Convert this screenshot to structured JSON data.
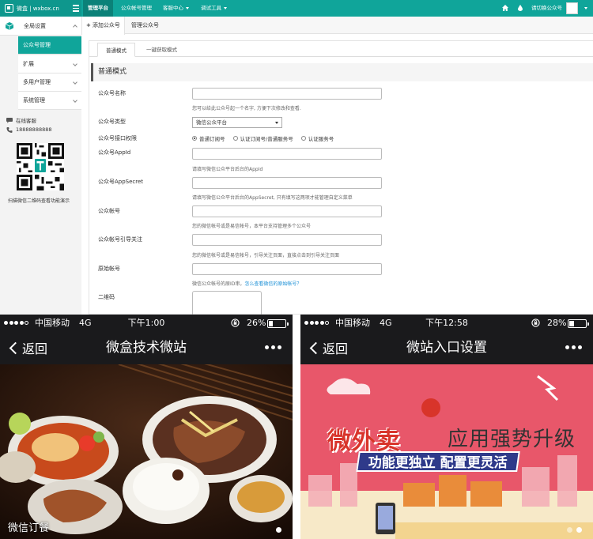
{
  "admin": {
    "brand": "微盒 | wxbox.cn",
    "nav": [
      {
        "label": "管理平台",
        "active": true,
        "caret": false
      },
      {
        "label": "公众帐号管理",
        "active": false,
        "caret": false
      },
      {
        "label": "客服中心",
        "active": false,
        "caret": true
      },
      {
        "label": "调试工具",
        "active": false,
        "caret": true
      }
    ],
    "switch_account": "请切换公众号",
    "sidebar": {
      "root": "全局设置",
      "items": [
        {
          "label": "公众号管理",
          "active": true
        },
        {
          "label": "扩展",
          "active": false
        },
        {
          "label": "多用户管理",
          "active": false
        },
        {
          "label": "系统管理",
          "active": false
        }
      ],
      "support_label": "在线客服",
      "phone": "18888888888",
      "qr_caption": "扫描微信二维码查看功能演示"
    },
    "toolbar": {
      "add": "添加公众号",
      "manage": "管理公众号"
    },
    "subtabs": [
      "普通模式",
      "一键获取模式"
    ],
    "section_title": "普通模式",
    "form": {
      "name_label": "公众号名称",
      "name_help": "您可以给此公众号起一个名字, 方便下次修改和查看.",
      "type_label": "公众号类型",
      "type_value": "微信公众平台",
      "access_label": "公众号接口权限",
      "access_options": [
        "普通订阅号",
        "认证订阅号/普通服务号",
        "认证服务号"
      ],
      "appid_label": "公众号AppId",
      "appid_help": "请填写微信公众平台后台的AppId",
      "secret_label": "公众号AppSecret",
      "secret_help": "请填写微信公众平台后台的AppSecret, 只有填写这两项才能管理自定义菜单",
      "account_label": "公众帐号",
      "account_help": "您的微信帐号或是易信帐号，本平台支持管理多个公众号",
      "follow_label": "公众帐号引导关注",
      "follow_help": "您的微信帐号或是易信帐号，引导关注页面，直接点击到引导关注页面",
      "original_label": "原始帐号",
      "original_help": "微信公众帐号的原ID串，",
      "original_link": "怎么查看微信的原始帐号？",
      "qrcode_label": "二维码"
    }
  },
  "phone1": {
    "carrier": "中国移动",
    "network": "4G",
    "time": "下午1:00",
    "battery": "26%",
    "battery_level": 0.26,
    "back": "返回",
    "title": "微盒技术微站",
    "caption": "微信订餐"
  },
  "phone2": {
    "carrier": "中国移动",
    "network": "4G",
    "time": "下午12:58",
    "battery": "28%",
    "battery_level": 0.28,
    "back": "返回",
    "title": "微站入口设置",
    "promo_title": "微外卖",
    "promo_right": "应用强势升级",
    "promo_sub": "功能更独立 配置更灵活"
  },
  "colors": {
    "brand": "#10a59a",
    "phone_bg": "#1a1a1c",
    "promo_bg": "#e8576a"
  }
}
